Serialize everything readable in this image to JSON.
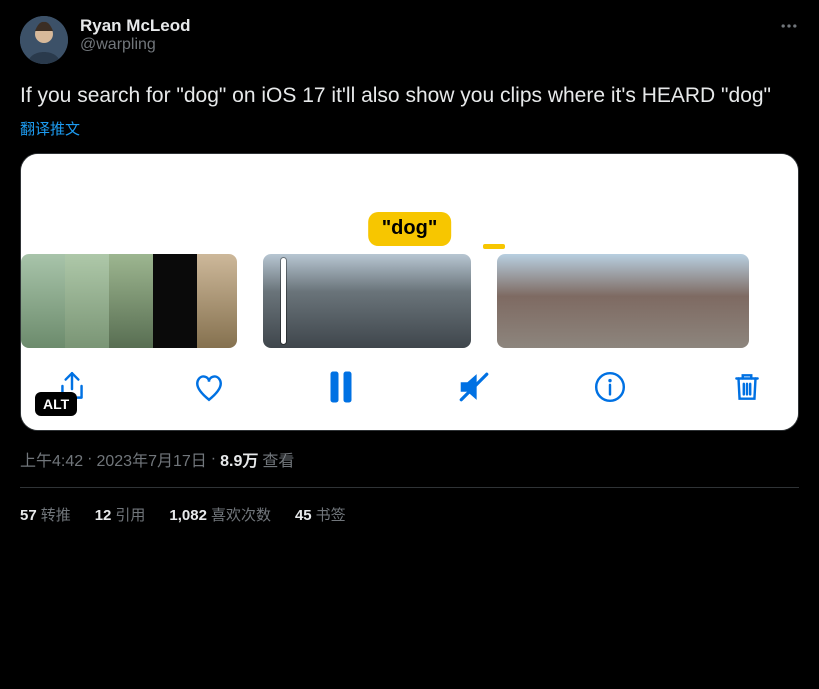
{
  "author": {
    "display_name": "Ryan McLeod",
    "handle": "@warpling"
  },
  "body_text": "If you search for \"dog\" on iOS 17 it'll also show you clips where it's HEARD \"dog\"",
  "translate_label": "翻译推文",
  "media": {
    "caption_pill": "\"dog\"",
    "alt_badge": "ALT",
    "toolbar_icons": {
      "share": "share-icon",
      "heart": "heart-icon",
      "pause": "pause-icon",
      "mute": "mute-icon",
      "info": "info-icon",
      "trash": "trash-icon"
    }
  },
  "meta": {
    "time": "上午4:42",
    "dot1": " · ",
    "date": "2023年7月17日",
    "dot2": " · ",
    "views_value": "8.9万",
    "views_label": " 查看"
  },
  "engagement": {
    "retweets_count": "57",
    "retweets_label": "转推",
    "quotes_count": "12",
    "quotes_label": "引用",
    "likes_count": "1,082",
    "likes_label": "喜欢次数",
    "bookmarks_count": "45",
    "bookmarks_label": "书签"
  }
}
